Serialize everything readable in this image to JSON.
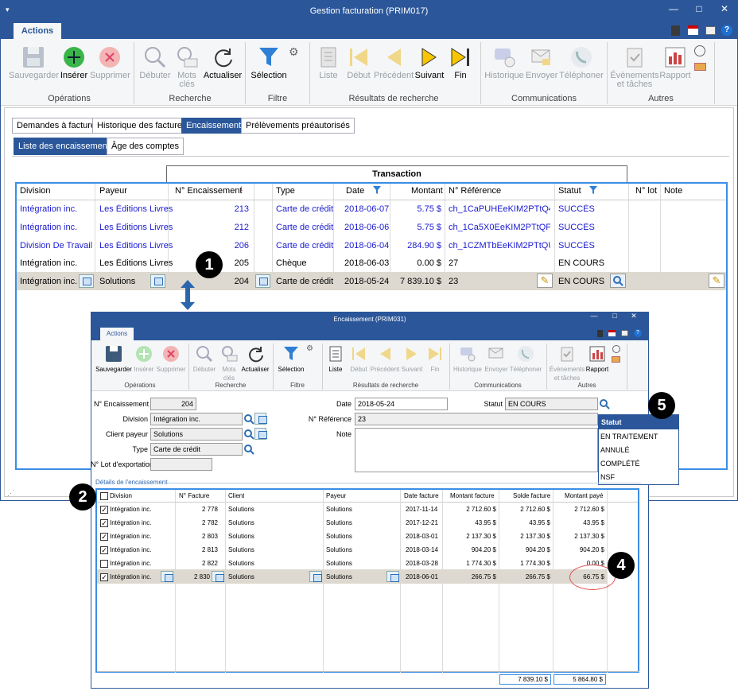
{
  "main": {
    "title": "Gestion facturation (PRIM017)",
    "tab": "Actions",
    "ribbon": {
      "operations": {
        "label": "Opérations",
        "save": "Sauvegarder",
        "insert": "Insérer",
        "delete": "Supprimer"
      },
      "search": {
        "label": "Recherche",
        "start": "Débuter",
        "keywords1": "Mots",
        "keywords2": "clés",
        "refresh": "Actualiser"
      },
      "filter": {
        "label": "Filtre",
        "selection": "Sélection"
      },
      "results": {
        "label": "Résultats de recherche",
        "list": "Liste",
        "first": "Début",
        "prev": "Précédent",
        "next": "Suivant",
        "last": "Fin"
      },
      "comms": {
        "label": "Communications",
        "history": "Historique",
        "send": "Envoyer",
        "phone": "Téléphoner"
      },
      "others": {
        "label": "Autres",
        "events1": "Évènements",
        "events2": "et tâches",
        "report": "Rapport"
      }
    },
    "tabs": [
      "Demandes à facturer",
      "Historique des factures",
      "Encaissements",
      "Prélèvements préautorisés"
    ],
    "subtabs": [
      "Liste des encaissements",
      "Âge des comptes"
    ],
    "group_header": "Transaction",
    "columns": [
      "Division",
      "Payeur",
      "N° Encaissement",
      "Type",
      "Date",
      "Montant",
      "N° Référence",
      "Statut",
      "N° lot",
      "Note"
    ],
    "rows": [
      [
        "Intégration inc.",
        "Les Éditions Livres",
        "213",
        "Carte de crédit",
        "2018-06-07",
        "5.75 $",
        "ch_1CaPUHEeKIM2PTtQ4v…",
        "SUCCÈS"
      ],
      [
        "Intégration inc.",
        "Les Éditions Livres",
        "212",
        "Carte de crédit",
        "2018-06-06",
        "5.75 $",
        "ch_1Ca5X0EeKIM2PTtQFS…",
        "SUCCÈS"
      ],
      [
        "Division De Travail",
        "Les Éditions Livres",
        "206",
        "Carte de crédit",
        "2018-06-04",
        "284.90 $",
        "ch_1CZMTbEeKIM2PTtQUV…",
        "SUCCÈS"
      ],
      [
        "Intégration inc.",
        "Les Éditions Livres",
        "205",
        "Chèque",
        "2018-06-03",
        "0.00 $",
        "27",
        "EN COURS"
      ],
      [
        "Intégration inc.",
        "Solutions",
        "204",
        "Carte de crédit",
        "2018-05-24",
        "7 839.10 $",
        "23",
        "EN COURS"
      ]
    ]
  },
  "badges": [
    "1",
    "2",
    "4",
    "5"
  ],
  "dialog": {
    "title": "Encaissement (PRIM031)",
    "tab": "Actions",
    "ribbon": {
      "save": "Sauvegarder",
      "insert": "Insérer",
      "delete": "Supprimer",
      "ops": "Opérations",
      "start": "Débuter",
      "kw1": "Mots",
      "kw2": "clés",
      "refresh": "Actualiser",
      "search": "Recherche",
      "selection": "Sélection",
      "filter": "Filtre",
      "list": "Liste",
      "first": "Début",
      "prev": "Précédent",
      "next": "Suivant",
      "last": "Fin",
      "results": "Résultats de recherche",
      "history": "Historique",
      "send": "Envoyer",
      "phone": "Téléphoner",
      "comms": "Communications",
      "events1": "Évènements",
      "events2": "et tâches",
      "report": "Rapport",
      "others": "Autres"
    },
    "form": {
      "num_label": "N° Encaissement",
      "num": "204",
      "division_label": "Division",
      "division": "Intégration inc.",
      "payer_label": "Client payeur",
      "payer": "Solutions",
      "type_label": "Type",
      "type": "Carte de crédit",
      "lot_label": "N° Lot d'exportation",
      "lot": "",
      "date_label": "Date",
      "date": "2018-05-24",
      "ref_label": "N° Référence",
      "ref": "23",
      "note_label": "Note",
      "note": "",
      "status_label": "Statut",
      "status": "EN COURS"
    },
    "status_dropdown": {
      "header": "Statut",
      "options": [
        "EN TRAITEMENT",
        "ANNULÉ",
        "COMPLÉTÉ",
        "NSF"
      ]
    },
    "details_label": "Détails de l'encaissement",
    "columns": [
      "Division",
      "N° Facture",
      "Client",
      "Payeur",
      "Date facture",
      "Montant facture",
      "Solde facture",
      "Montant payé"
    ],
    "rows": [
      {
        "checked": "✓",
        "division": "Intégration inc.",
        "invoice": "2 778",
        "client": "Solutions",
        "payer": "Solutions",
        "date": "2017-11-14",
        "amount": "2 712.60 $",
        "balance": "2 712.60 $",
        "paid": "2 712.60 $"
      },
      {
        "checked": "✓",
        "division": "Intégration inc.",
        "invoice": "2 782",
        "client": "Solutions",
        "payer": "Solutions",
        "date": "2017-12-21",
        "amount": "43.95 $",
        "balance": "43.95 $",
        "paid": "43.95 $"
      },
      {
        "checked": "✓",
        "division": "Intégration inc.",
        "invoice": "2 803",
        "client": "Solutions",
        "payer": "Solutions",
        "date": "2018-03-01",
        "amount": "2 137.30 $",
        "balance": "2 137.30 $",
        "paid": "2 137.30 $"
      },
      {
        "checked": "✓",
        "division": "Intégration inc.",
        "invoice": "2 813",
        "client": "Solutions",
        "payer": "Solutions",
        "date": "2018-03-14",
        "amount": "904.20 $",
        "balance": "904.20 $",
        "paid": "904.20 $"
      },
      {
        "checked": "",
        "division": "Intégration inc.",
        "invoice": "2 822",
        "client": "Solutions",
        "payer": "Solutions",
        "date": "2018-03-28",
        "amount": "1 774.30 $",
        "balance": "1 774.30 $",
        "paid": "0.00 $"
      },
      {
        "checked": "✓",
        "division": "Intégration inc.",
        "invoice": "2 830",
        "client": "Solutions",
        "payer": "Solutions",
        "date": "2018-06-01",
        "amount": "266.75 $",
        "balance": "266.75 $",
        "paid": "66.75 $"
      }
    ],
    "totals": {
      "balance": "7 839.10 $",
      "paid": "5 864.80 $"
    }
  }
}
